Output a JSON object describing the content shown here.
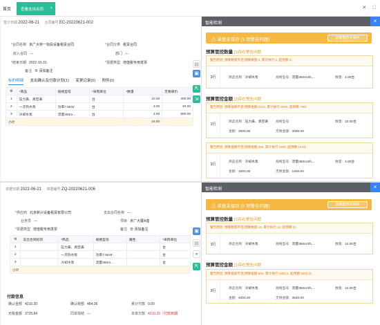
{
  "topbar": {
    "home": "首页",
    "active_tab": "查看支出合同",
    "close": "×",
    "icons": [
      "close-icon",
      "expand-icon"
    ]
  },
  "doc1": {
    "sign_date_label": "签订日期",
    "sign_date": "2022-06-21",
    "contract_no_label": "合同编号",
    "contract_no": "EC-20220621-002",
    "fields": {
      "contract_name_label": "合同名称",
      "contract_name": "京广大桥一标段设备租赁合同",
      "category_label": "合同分类",
      "category": "租赁合同",
      "income_contract_label": "收入合同",
      "income_contract": "---",
      "dept_label": "部门",
      "dept": "---",
      "end_date_label": "结束日期",
      "end_date": "2022-10-31",
      "invoice_label": "票据类型",
      "invoice": "增值税专用发票",
      "remark_label": "备注",
      "remark_link": "添加备注"
    },
    "tabs": [
      "标的明细",
      "支出确认及付款计划(1)",
      "变更记录(0)",
      "附件(0)"
    ],
    "table": {
      "headers": [
        "",
        "*商品",
        "规格型号",
        "*采购单位",
        "*数量",
        "无税单价"
      ],
      "rows": [
        [
          "1",
          "压力表、真空表",
          "",
          "台",
          "10.00",
          "300.00"
        ],
        [
          "2",
          "一次热水泵",
          "功率7.5KW",
          "台",
          "3.00",
          "40.00"
        ],
        [
          "3",
          "冷却水泵",
          "流量350m...",
          "台",
          "3.00",
          "500.00"
        ]
      ],
      "sum_label": "小计",
      "sum_qty": "16.00"
    }
  },
  "panel1": {
    "title": "智能检测",
    "close": "×",
    "banner": "单据未保存 [3 项警告问题]",
    "ignore_btn": "忽略警告并保存",
    "sec1_title": "预算管控数量",
    "sec1_count": "[1]存在警告问题",
    "sec1_card": {
      "warn": "警告原因: 预算数量不足(预算数量:2, 累计执行:3, 超预算:1)",
      "idx": "3行",
      "name_k": "商品名称:",
      "name_v": "冷却水泵",
      "spec_k": "规格型号:",
      "spec_v": "流量350m3/h,...",
      "qty_k": "数量:",
      "qty_v": "3.00台"
    },
    "sec2_title": "预算管控金额",
    "sec2_count": "[2]存在警告问题",
    "sec2_cards": [
      {
        "warn": "警告原因: 预算金额不足(预算金额:2214, 累计执行:3000, 超预算:786)",
        "idx": "1行",
        "name_k": "商品名称:",
        "name_v": "压力表、真空表",
        "spec_k": "规格型号:",
        "spec_v": "",
        "qty_k": "数量:",
        "qty_v": "10.00台",
        "amt_k": "金额:",
        "amt_v": "3000.00",
        "namt_k": "无税金额:",
        "namt_v": "3000.00"
      },
      {
        "warn": "警告原因: 预算金额不足(预算金额:256, 累计执行:1500, 超预算:1244)",
        "idx": "3行",
        "name_k": "商品名称:",
        "name_v": "冷却水泵",
        "spec_k": "规格型号:",
        "spec_v": "流量350m3/h,...",
        "qty_k": "数量:",
        "qty_v": "3.00台",
        "amt_k": "金额:",
        "amt_v": "1500.00",
        "namt_k": "无税金额:",
        "namt_v": "1500.00"
      }
    ]
  },
  "doc2": {
    "bill_date_label": "单据日期",
    "bill_date": "2022-06-21",
    "bill_no_label": "单据编号",
    "bill_no": "ZQ-20220621-006",
    "fields": {
      "supplier_label": "供应商",
      "supplier": "北京新兴设备租赁有限公司",
      "contract_label": "支出合同名称",
      "contract": "---",
      "staff_label": "业务员",
      "staff": "---",
      "project_label": "项目",
      "project": "京广大厦A座",
      "invoice_label": "票据类型",
      "invoice": "增值税专用发票",
      "remark_label": "备注",
      "remark_link": "添加备注"
    },
    "table": {
      "headers": [
        "",
        "支出合同标的",
        "*商品",
        "规格型号",
        "属性",
        "*采购单位"
      ],
      "rows": [
        [
          "1",
          "",
          "压力表、真空表",
          "",
          "",
          "台"
        ],
        [
          "2",
          "",
          "一次热水泵",
          "功率7.5KW",
          "",
          "台"
        ],
        [
          "3",
          "",
          "冷却水泵",
          "流量350m...",
          "",
          "台"
        ]
      ],
      "sum_label": "小计"
    },
    "pay": {
      "title": "付款信息",
      "confirm_amt_label": "确认金额",
      "confirm_amt": "4210.20",
      "confirm_tax_label": "确认税额",
      "confirm_tax": "484.36",
      "paid_label": "累计付款",
      "paid": "0.00",
      "notax_label": "无税金额",
      "notax": "3725.84",
      "sync_label": "同单现结",
      "sync": "---",
      "owed_label": "本单欠款",
      "owed": "4210.20（付款到期"
    }
  },
  "panel2": {
    "title": "智能检测",
    "close": "×",
    "banner": "单据未保存 [3 项警告问题]",
    "ignore_btn": "忽略警告并保存",
    "sec1_title": "预算管控数量",
    "sec1_count": "[1]存在警告问题",
    "sec1_card": {
      "warn": "警告原因: 预算数量不足(预算数量:10, 累计执行:12, 超预算:2)",
      "idx": "3行",
      "name_k": "商品名称:",
      "name_v": "冷却水泵",
      "spec_k": "规格型号:",
      "spec_v": "流量350m3/h,...",
      "qty_k": "数量:",
      "qty_v": "12.00台"
    },
    "sec2_title": "预算管控金额",
    "sec2_count": "[1]存在警告问题",
    "sec2_card": {
      "warn": "警告原因: 预算金额不足(预算金额:800, 累计执行:4000.2, 超预算:3200.2)",
      "idx": "3行",
      "name_k": "商品名称:",
      "name_v": "冷却水泵",
      "spec_k": "规格型号:",
      "spec_v": "流量350m3/h,...",
      "qty_k": "数量:",
      "qty_v": "12.00台",
      "amt_k": "金额:",
      "amt_v": "4000.20",
      "namt_k": "无税金额:",
      "namt_v": "3540.00"
    }
  }
}
